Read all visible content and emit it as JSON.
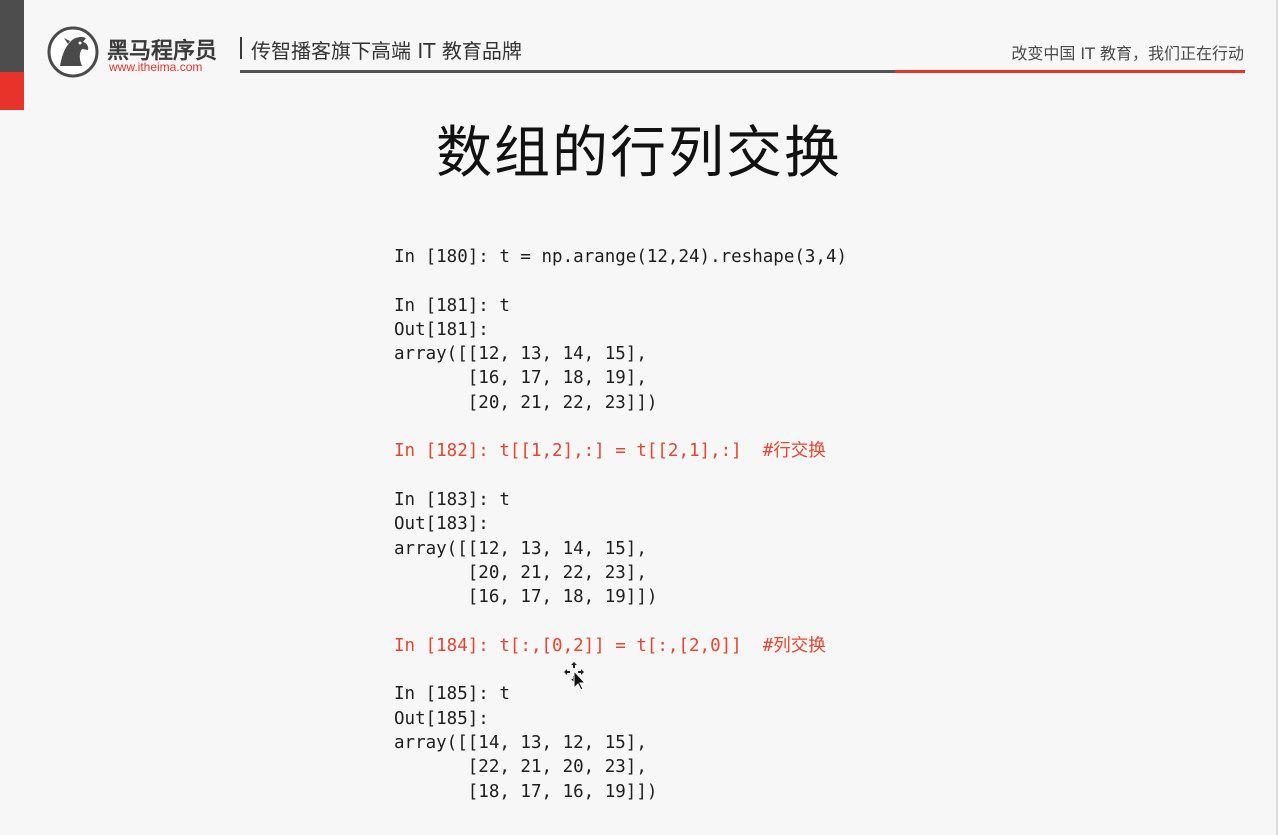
{
  "header": {
    "brand_name": "黑马程序员",
    "brand_url": "www.itheima.com",
    "tagline": "传智播客旗下高端 IT 教育品牌",
    "slogan": "改变中国 IT 教育，我们正在行动"
  },
  "slide": {
    "title": "数组的行列交换"
  },
  "code_lines": [
    {
      "text": "In [180]: t = np.arange(12,24).reshape(3,4)",
      "highlight": false
    },
    {
      "text": "",
      "highlight": false
    },
    {
      "text": "In [181]: t",
      "highlight": false
    },
    {
      "text": "Out[181]:",
      "highlight": false
    },
    {
      "text": "array([[12, 13, 14, 15],",
      "highlight": false
    },
    {
      "text": "       [16, 17, 18, 19],",
      "highlight": false
    },
    {
      "text": "       [20, 21, 22, 23]])",
      "highlight": false
    },
    {
      "text": "",
      "highlight": false
    },
    {
      "text": "In [182]: t[[1,2],:] = t[[2,1],:]  #行交换",
      "highlight": true
    },
    {
      "text": "",
      "highlight": false
    },
    {
      "text": "In [183]: t",
      "highlight": false
    },
    {
      "text": "Out[183]:",
      "highlight": false
    },
    {
      "text": "array([[12, 13, 14, 15],",
      "highlight": false
    },
    {
      "text": "       [20, 21, 22, 23],",
      "highlight": false
    },
    {
      "text": "       [16, 17, 18, 19]])",
      "highlight": false
    },
    {
      "text": "",
      "highlight": false
    },
    {
      "text": "In [184]: t[:,[0,2]] = t[:,[2,0]]  #列交换",
      "highlight": true
    },
    {
      "text": "",
      "highlight": false
    },
    {
      "text": "In [185]: t",
      "highlight": false
    },
    {
      "text": "Out[185]:",
      "highlight": false
    },
    {
      "text": "array([[14, 13, 12, 15],",
      "highlight": false
    },
    {
      "text": "       [22, 21, 20, 23],",
      "highlight": false
    },
    {
      "text": "       [18, 17, 16, 19]])",
      "highlight": false
    }
  ],
  "colors": {
    "brand_red": "#e8332b",
    "highlight_red": "#e8452f",
    "text_dark": "#1e1e1e"
  },
  "icons": {
    "logo": "horse-head-logo-icon",
    "cursor": "move-cursor-icon"
  }
}
